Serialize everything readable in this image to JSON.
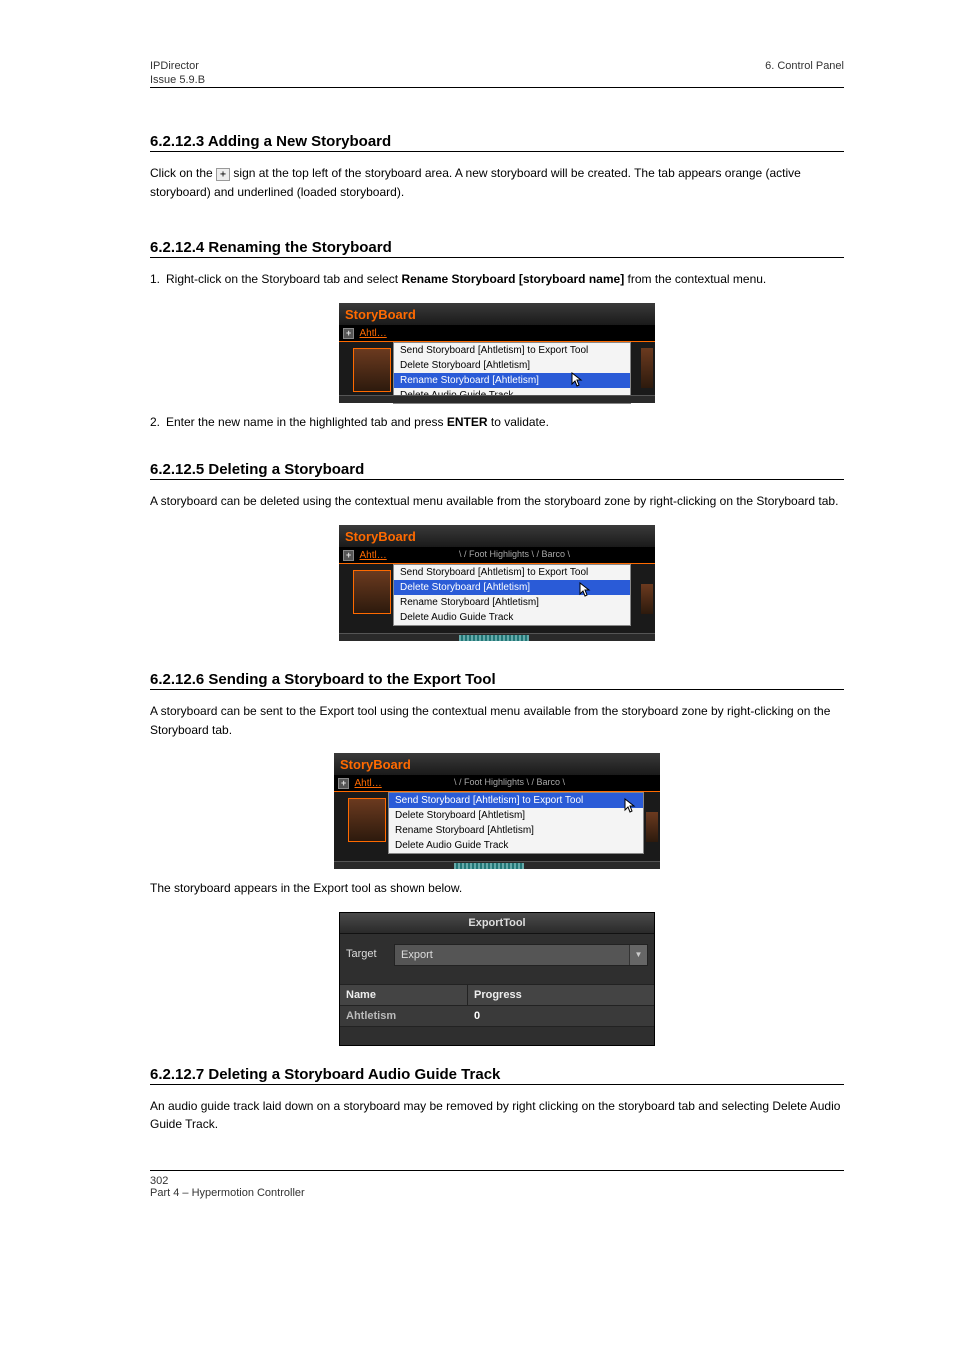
{
  "header": {
    "doc_title": "IPDirector",
    "section_path": "6. Control Panel",
    "chapter": "Issue 5.9.B"
  },
  "s1": {
    "heading": "6.2.12.3 Adding a New Storyboard",
    "p1_part1": "Click on the ",
    "plus_label": "+",
    "p1_part2": " sign at the top left of the storyboard area. A new storyboard will be created. The tab appears orange (active storyboard) and underlined (loaded storyboard)."
  },
  "s2": {
    "heading": "6.2.12.4 Renaming the Storyboard",
    "step1_pre": "Right-click on the Storyboard tab and select ",
    "step1_strong": "Rename Storyboard [storyboard name]",
    "step1_post": " from the contextual menu.",
    "step2_pre": "Enter the new name in the highlighted tab and press ",
    "step2_strong": "ENTER",
    "step2_post": " to validate."
  },
  "s3": {
    "heading": "6.2.12.5 Deleting a Storyboard",
    "p1": "A storyboard can be deleted using the contextual menu available from the storyboard zone by right-clicking on the Storyboard tab."
  },
  "s4": {
    "heading": "6.2.12.6 Sending a Storyboard to the Export Tool",
    "p1": "A storyboard can be sent to the Export tool using the contextual menu available from the storyboard zone by right-clicking on the Storyboard tab.",
    "p2": "The storyboard appears in the Export tool as shown below."
  },
  "s5": {
    "heading": "6.2.12.7 Deleting a Storyboard Audio Guide Track",
    "p1": "An audio guide track laid down on a storyboard may be removed by right clicking on the storyboard tab and selecting Delete Audio Guide Track."
  },
  "sb_menu": {
    "title": "StoryBoard",
    "tab1": "Ahtl…",
    "tabs_more_1": "\\ / Foot Highlights \\ / Barco \\",
    "tabs_more_2": "\\ / Foot Highlights \\ / Barco \\",
    "items": [
      "Send  Storyboard [Ahtletism] to Export Tool",
      "Delete Storyboard [Ahtletism]",
      "Rename Storyboard [Ahtletism]",
      "Delete Audio Guide Track"
    ]
  },
  "export_tool": {
    "title": "ExportTool",
    "target_label": "Target",
    "select_value": "Export",
    "col_name": "Name",
    "col_progress": "Progress",
    "row_name": "Ahtletism",
    "row_progress": "0"
  },
  "footer": {
    "page": "302",
    "left": "Part 4 – Hypermotion Controller",
    "right": ""
  }
}
